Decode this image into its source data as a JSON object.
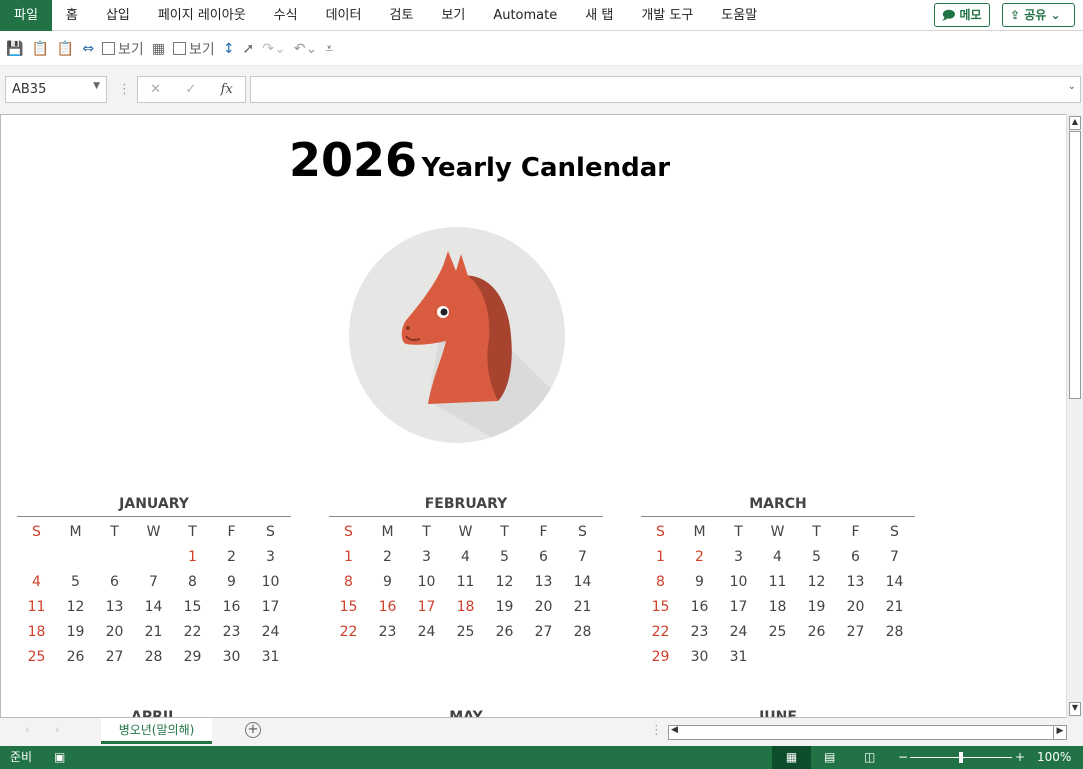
{
  "menu": [
    "파일",
    "홈",
    "삽입",
    "페이지 레이아웃",
    "수식",
    "데이터",
    "검토",
    "보기",
    "Automate",
    "새 탭",
    "개발 도구",
    "도움말"
  ],
  "buttons": {
    "memo": "메모",
    "share": "공유"
  },
  "qat": {
    "view1": "보기",
    "view2": "보기"
  },
  "formula": {
    "name_box": "AB35",
    "fx": "fx",
    "value": ""
  },
  "title": {
    "year": "2026",
    "text": "Yearly Canlendar"
  },
  "weekdays": [
    "S",
    "M",
    "T",
    "W",
    "T",
    "F",
    "S"
  ],
  "months": [
    {
      "name": "JANUARY",
      "days": [
        [
          "",
          "",
          "",
          "",
          "1",
          "2",
          "3"
        ],
        [
          "4",
          "5",
          "6",
          "7",
          "8",
          "9",
          "10"
        ],
        [
          "11",
          "12",
          "13",
          "14",
          "15",
          "16",
          "17"
        ],
        [
          "18",
          "19",
          "20",
          "21",
          "22",
          "23",
          "24"
        ],
        [
          "25",
          "26",
          "27",
          "28",
          "29",
          "30",
          "31"
        ]
      ],
      "holidays": [
        "1"
      ]
    },
    {
      "name": "FEBRUARY",
      "days": [
        [
          "1",
          "2",
          "3",
          "4",
          "5",
          "6",
          "7"
        ],
        [
          "8",
          "9",
          "10",
          "11",
          "12",
          "13",
          "14"
        ],
        [
          "15",
          "16",
          "17",
          "18",
          "19",
          "20",
          "21"
        ],
        [
          "22",
          "23",
          "24",
          "25",
          "26",
          "27",
          "28"
        ]
      ],
      "holidays": [
        "16",
        "17",
        "18"
      ]
    },
    {
      "name": "MARCH",
      "days": [
        [
          "1",
          "2",
          "3",
          "4",
          "5",
          "6",
          "7"
        ],
        [
          "8",
          "9",
          "10",
          "11",
          "12",
          "13",
          "14"
        ],
        [
          "15",
          "16",
          "17",
          "18",
          "19",
          "20",
          "21"
        ],
        [
          "22",
          "23",
          "24",
          "25",
          "26",
          "27",
          "28"
        ],
        [
          "29",
          "30",
          "31",
          "",
          "",
          "",
          ""
        ]
      ],
      "holidays": [
        "2"
      ]
    }
  ],
  "next_months": [
    "APRIL",
    "MAY",
    "JUNE"
  ],
  "sheet_tab": "병오년(말의해)",
  "status": {
    "ready": "준비",
    "zoom": "100%"
  },
  "colors": {
    "accent": "#217346",
    "holiday": "#d0402a",
    "horse": "#d95c40"
  }
}
